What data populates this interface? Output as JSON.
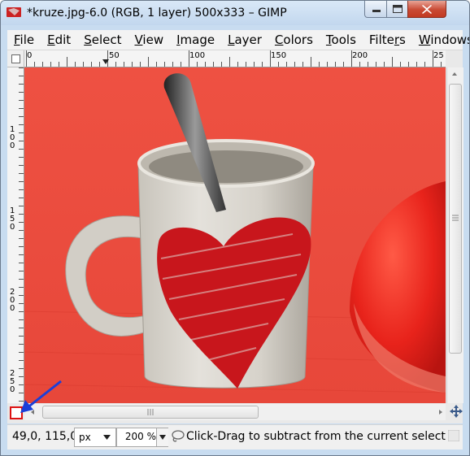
{
  "window": {
    "title": "*kruze.jpg-6.0 (RGB, 1 layer) 500x333 – GIMP",
    "app_icon": "gimp-wilber-icon",
    "controls": {
      "minimize": "minimize-icon",
      "maximize": "maximize-icon",
      "close": "close-icon"
    }
  },
  "menubar": {
    "items": [
      {
        "label": "File",
        "mnemonic": "F",
        "rest": "ile"
      },
      {
        "label": "Edit",
        "mnemonic": "E",
        "rest": "dit"
      },
      {
        "label": "Select",
        "mnemonic": "S",
        "rest": "elect"
      },
      {
        "label": "View",
        "mnemonic": "V",
        "rest": "iew"
      },
      {
        "label": "Image",
        "mnemonic": "I",
        "rest": "mage"
      },
      {
        "label": "Layer",
        "mnemonic": "L",
        "rest": "ayer"
      },
      {
        "label": "Colors",
        "mnemonic": "C",
        "rest": "olors"
      },
      {
        "label": "Tools",
        "mnemonic": "T",
        "rest": "ools"
      },
      {
        "label": "Filters",
        "mnemonic": "r",
        "pre": "Filte",
        "rest": "s"
      },
      {
        "label": "Windows",
        "mnemonic": "W",
        "rest": "indows"
      },
      {
        "label": "Help",
        "mnemonic": "H",
        "rest": "elp"
      }
    ]
  },
  "rulers": {
    "horizontal_labels": [
      "0",
      "50",
      "100",
      "150",
      "200",
      "25"
    ],
    "vertical_labels": [
      "100",
      "150",
      "200",
      "250"
    ]
  },
  "canvas": {
    "image_description_colors": {
      "background": "#e8493a",
      "mug": "#d8d4cc",
      "heart": "#c8161c",
      "spoon": "#3a3a3a",
      "ball": "#e8241c"
    }
  },
  "statusbar": {
    "coordinates": "49,0, 115,0",
    "unit": "px",
    "zoom": "200 %",
    "message": "Click-Drag to subtract from the current selecti...",
    "message_icon": "lasso-icon",
    "cancel_icon": "cancel-icon"
  },
  "annotation": {
    "color": "#1a3fd8"
  }
}
